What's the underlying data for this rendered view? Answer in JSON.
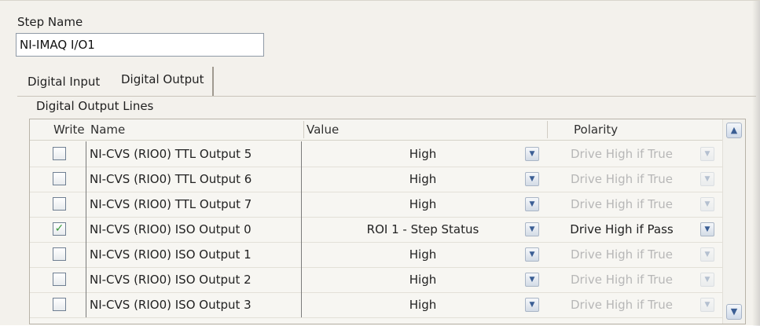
{
  "step": {
    "label": "Step Name",
    "value": "NI-IMAQ I/O1"
  },
  "tabs": [
    {
      "label": "Digital Input",
      "selected": false
    },
    {
      "label": "Digital Output",
      "selected": true
    }
  ],
  "group_label": "Digital Output Lines",
  "table": {
    "headers": {
      "write": "Write",
      "name": "Name",
      "value": "Value",
      "polarity": "Polarity"
    },
    "rows": [
      {
        "checked": false,
        "name": "NI-CVS (RIO0) TTL Output 5",
        "value": "High",
        "polarity": "Drive High if True",
        "polarity_enabled": false
      },
      {
        "checked": false,
        "name": "NI-CVS (RIO0) TTL Output 6",
        "value": "High",
        "polarity": "Drive High if True",
        "polarity_enabled": false
      },
      {
        "checked": false,
        "name": "NI-CVS (RIO0) TTL Output 7",
        "value": "High",
        "polarity": "Drive High if True",
        "polarity_enabled": false
      },
      {
        "checked": true,
        "name": "NI-CVS (RIO0) ISO Output 0",
        "value": "ROI 1 - Step Status",
        "polarity": "Drive High if Pass",
        "polarity_enabled": true
      },
      {
        "checked": false,
        "name": "NI-CVS (RIO0) ISO Output 1",
        "value": "High",
        "polarity": "Drive High if True",
        "polarity_enabled": false
      },
      {
        "checked": false,
        "name": "NI-CVS (RIO0) ISO Output 2",
        "value": "High",
        "polarity": "Drive High if True",
        "polarity_enabled": false
      },
      {
        "checked": false,
        "name": "NI-CVS (RIO0) ISO Output 3",
        "value": "High",
        "polarity": "Drive High if True",
        "polarity_enabled": false
      }
    ]
  },
  "icons": {
    "checkmark": "checkmark-icon",
    "dropdown": "chevron-down-icon",
    "scroll_up": "chevron-up-icon",
    "scroll_down": "chevron-down-icon"
  },
  "colors": {
    "panel_bg": "#f3f1ec",
    "disabled_text": "#b7b7b7",
    "check_green": "#3a9a3a",
    "scroll_arrow": "#3b5e94"
  }
}
